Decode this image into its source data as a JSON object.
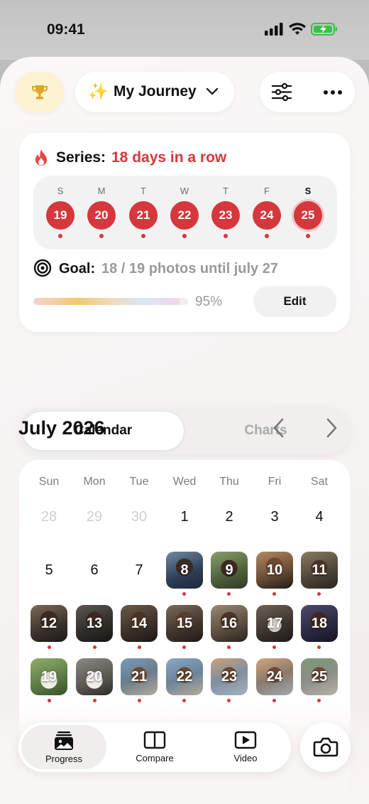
{
  "status_bar": {
    "time": "09:41"
  },
  "header": {
    "title": "My Journey",
    "sparkle": "✨"
  },
  "series": {
    "label": "Series:",
    "value": "18 days in a row"
  },
  "week": {
    "days": [
      "S",
      "M",
      "T",
      "W",
      "T",
      "F",
      "S"
    ],
    "dates": [
      "19",
      "20",
      "21",
      "22",
      "23",
      "24",
      "25"
    ]
  },
  "goal": {
    "label": "Goal:",
    "value": "18 / 19 photos until july 27",
    "percent": "95%",
    "progress": 0.95,
    "edit_label": "Edit"
  },
  "segments": {
    "calendar": "Calendar",
    "charts": "Charts",
    "selected": "Calendar"
  },
  "month": {
    "title": "July 2026"
  },
  "calendar": {
    "weekdays": [
      "Sun",
      "Mon",
      "Tue",
      "Wed",
      "Thu",
      "Fri",
      "Sat"
    ],
    "row1": [
      "28",
      "29",
      "30",
      "1",
      "2",
      "3",
      "4"
    ],
    "row2": [
      "5",
      "6",
      "7",
      "8",
      "9",
      "10",
      "11"
    ],
    "row3": [
      "12",
      "13",
      "14",
      "15",
      "16",
      "17",
      "18"
    ],
    "row4": [
      "19",
      "20",
      "21",
      "22",
      "23",
      "24",
      "25"
    ]
  },
  "bottom_nav": {
    "progress": "Progress",
    "compare": "Compare",
    "video": "Video"
  },
  "colors": {
    "accent": "#d6373c",
    "trophy": "#e0a41e",
    "trophy_bg": "#fdf3d2"
  },
  "icons": [
    "trophy-icon",
    "sparkles-icon",
    "chevron-down-icon",
    "sliders-icon",
    "more-icon",
    "flame-icon",
    "target-icon",
    "chevron-left-icon",
    "chevron-right-icon",
    "photos-icon",
    "compare-icon",
    "play-icon",
    "camera-icon"
  ]
}
